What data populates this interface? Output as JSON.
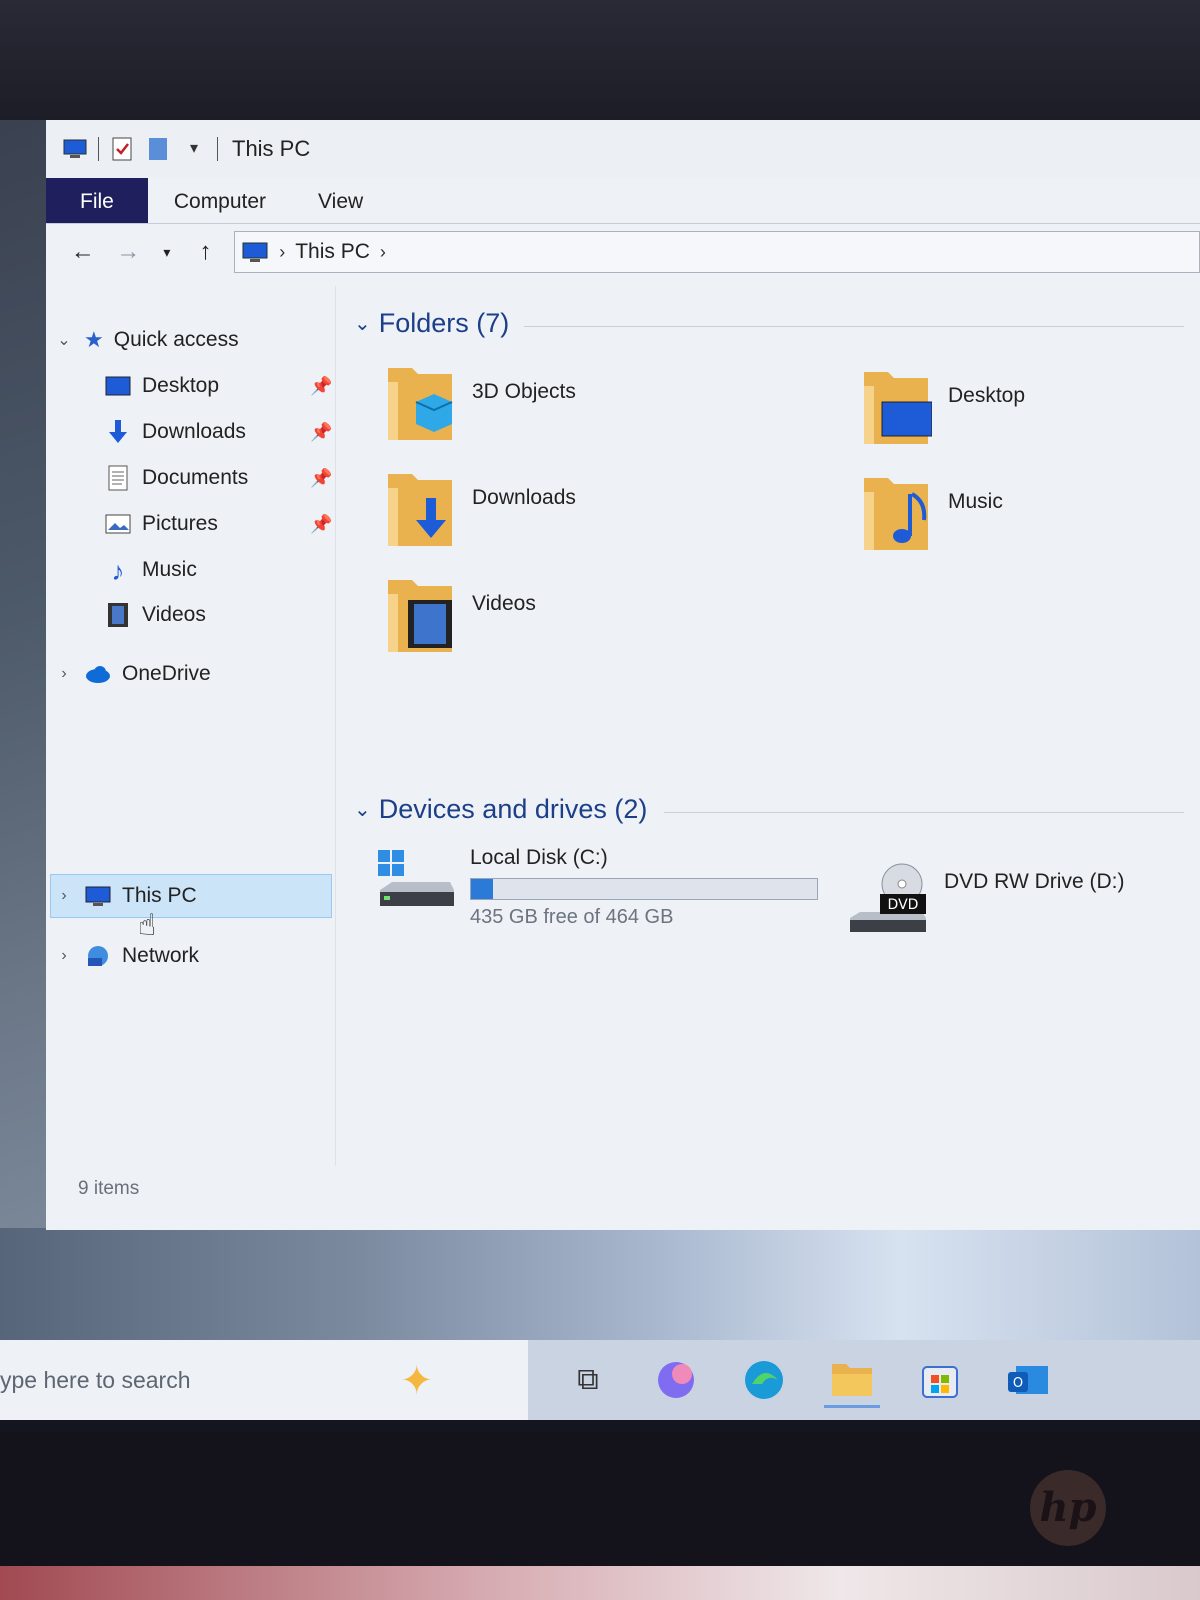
{
  "window": {
    "title": "This PC",
    "ribbon_tabs": [
      "File",
      "Computer",
      "View"
    ]
  },
  "address": {
    "location": "This PC"
  },
  "nav_pane": {
    "quick_access_label": "Quick access",
    "quick_access_items": [
      {
        "label": "Desktop",
        "icon": "desktop-icon",
        "pinned": true
      },
      {
        "label": "Downloads",
        "icon": "download-icon",
        "pinned": true
      },
      {
        "label": "Documents",
        "icon": "documents-icon",
        "pinned": true
      },
      {
        "label": "Pictures",
        "icon": "pictures-icon",
        "pinned": true
      },
      {
        "label": "Music",
        "icon": "music-icon",
        "pinned": false
      },
      {
        "label": "Videos",
        "icon": "videos-icon",
        "pinned": false
      }
    ],
    "onedrive_label": "OneDrive",
    "this_pc_label": "This PC",
    "network_label": "Network"
  },
  "content": {
    "folders_header": "Folders (7)",
    "folders": [
      {
        "label": "3D Objects",
        "icon": "3d-objects-folder-icon"
      },
      {
        "label": "Desktop",
        "icon": "desktop-folder-icon"
      },
      {
        "label": "Downloads",
        "icon": "downloads-folder-icon"
      },
      {
        "label": "Music",
        "icon": "music-folder-icon"
      },
      {
        "label": "Videos",
        "icon": "videos-folder-icon"
      }
    ],
    "drives_header": "Devices and drives (2)",
    "drives": [
      {
        "label": "Local Disk (C:)",
        "free_text": "435 GB free of 464 GB",
        "used_fraction": 0.0625
      },
      {
        "label": "DVD RW Drive (D:)",
        "badge": "DVD"
      }
    ]
  },
  "status": {
    "item_count": "9 items"
  },
  "taskbar": {
    "search_placeholder": "ype here to search",
    "icons": [
      "task-view-icon",
      "copilot-icon",
      "edge-icon",
      "file-explorer-icon",
      "store-icon",
      "outlook-icon"
    ]
  },
  "colors": {
    "accent": "#1f1f5e",
    "selection": "#cce4f7",
    "group_header": "#1c3f8a",
    "drive_fill": "#2b7ad8"
  }
}
